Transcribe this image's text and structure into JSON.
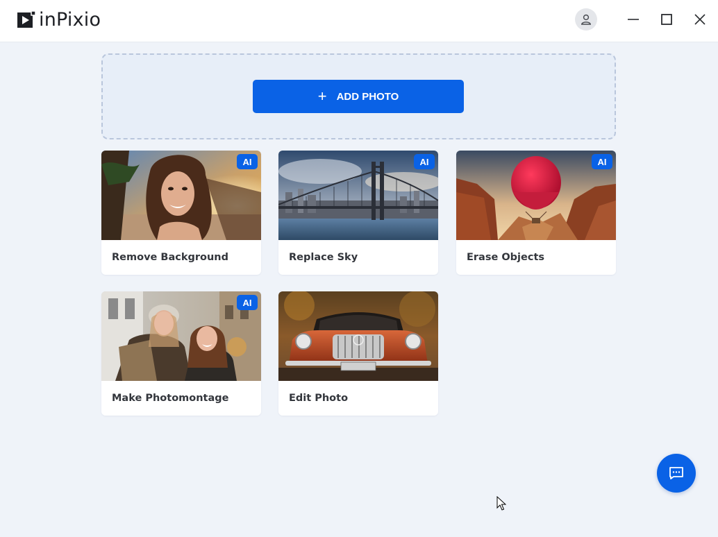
{
  "app": {
    "logo_text": "inPixio"
  },
  "titlebar": {
    "account_icon": "user-icon",
    "minimize_icon": "minimize-icon",
    "maximize_icon": "maximize-icon",
    "close_icon": "close-icon"
  },
  "dropzone": {
    "add_photo_label": "ADD PHOTO",
    "add_icon": "plus-icon"
  },
  "cards": [
    {
      "label": "Remove Background",
      "badge": "AI"
    },
    {
      "label": "Replace Sky",
      "badge": "AI"
    },
    {
      "label": "Erase Objects",
      "badge": "AI"
    },
    {
      "label": "Make Photomontage",
      "badge": "AI"
    },
    {
      "label": "Edit Photo"
    }
  ],
  "chat": {
    "icon": "chat-icon"
  },
  "colors": {
    "accent": "#0a62e6",
    "background": "#eff3f9",
    "dropzone": "#e7eef8"
  }
}
